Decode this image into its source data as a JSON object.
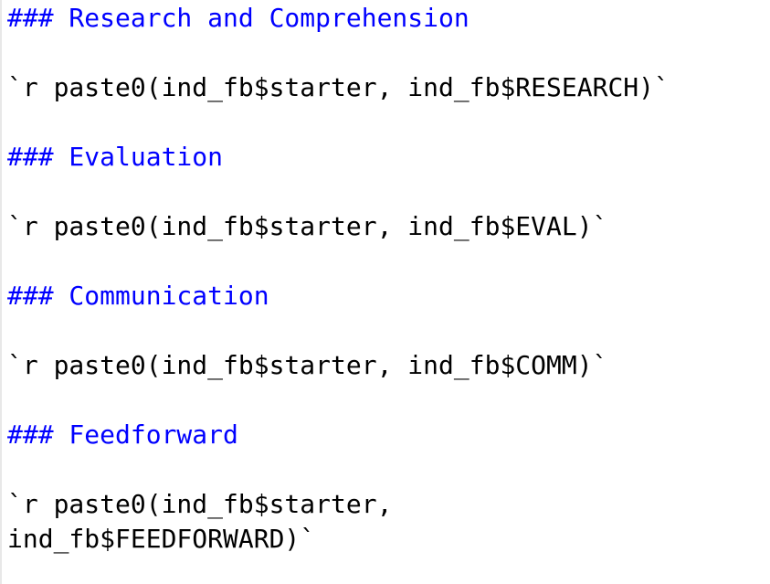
{
  "editor": {
    "lines": [
      {
        "kind": "heading",
        "text": "### Research and Comprehension"
      },
      {
        "kind": "code",
        "text": "`r paste0(ind_fb$starter, ind_fb$RESEARCH)`"
      },
      {
        "kind": "heading",
        "text": "### Evaluation"
      },
      {
        "kind": "code",
        "text": "`r paste0(ind_fb$starter, ind_fb$EVAL)`"
      },
      {
        "kind": "heading",
        "text": "### Communication"
      },
      {
        "kind": "code",
        "text": "`r paste0(ind_fb$starter, ind_fb$COMM)`"
      },
      {
        "kind": "heading",
        "text": "### Feedforward"
      },
      {
        "kind": "code",
        "text": "`r paste0(ind_fb$starter,"
      },
      {
        "kind": "code",
        "text": "ind_fb$FEEDFORWARD)`"
      }
    ]
  },
  "colors": {
    "heading": "#0000ff",
    "code": "#000000",
    "background": "#ffffff"
  }
}
